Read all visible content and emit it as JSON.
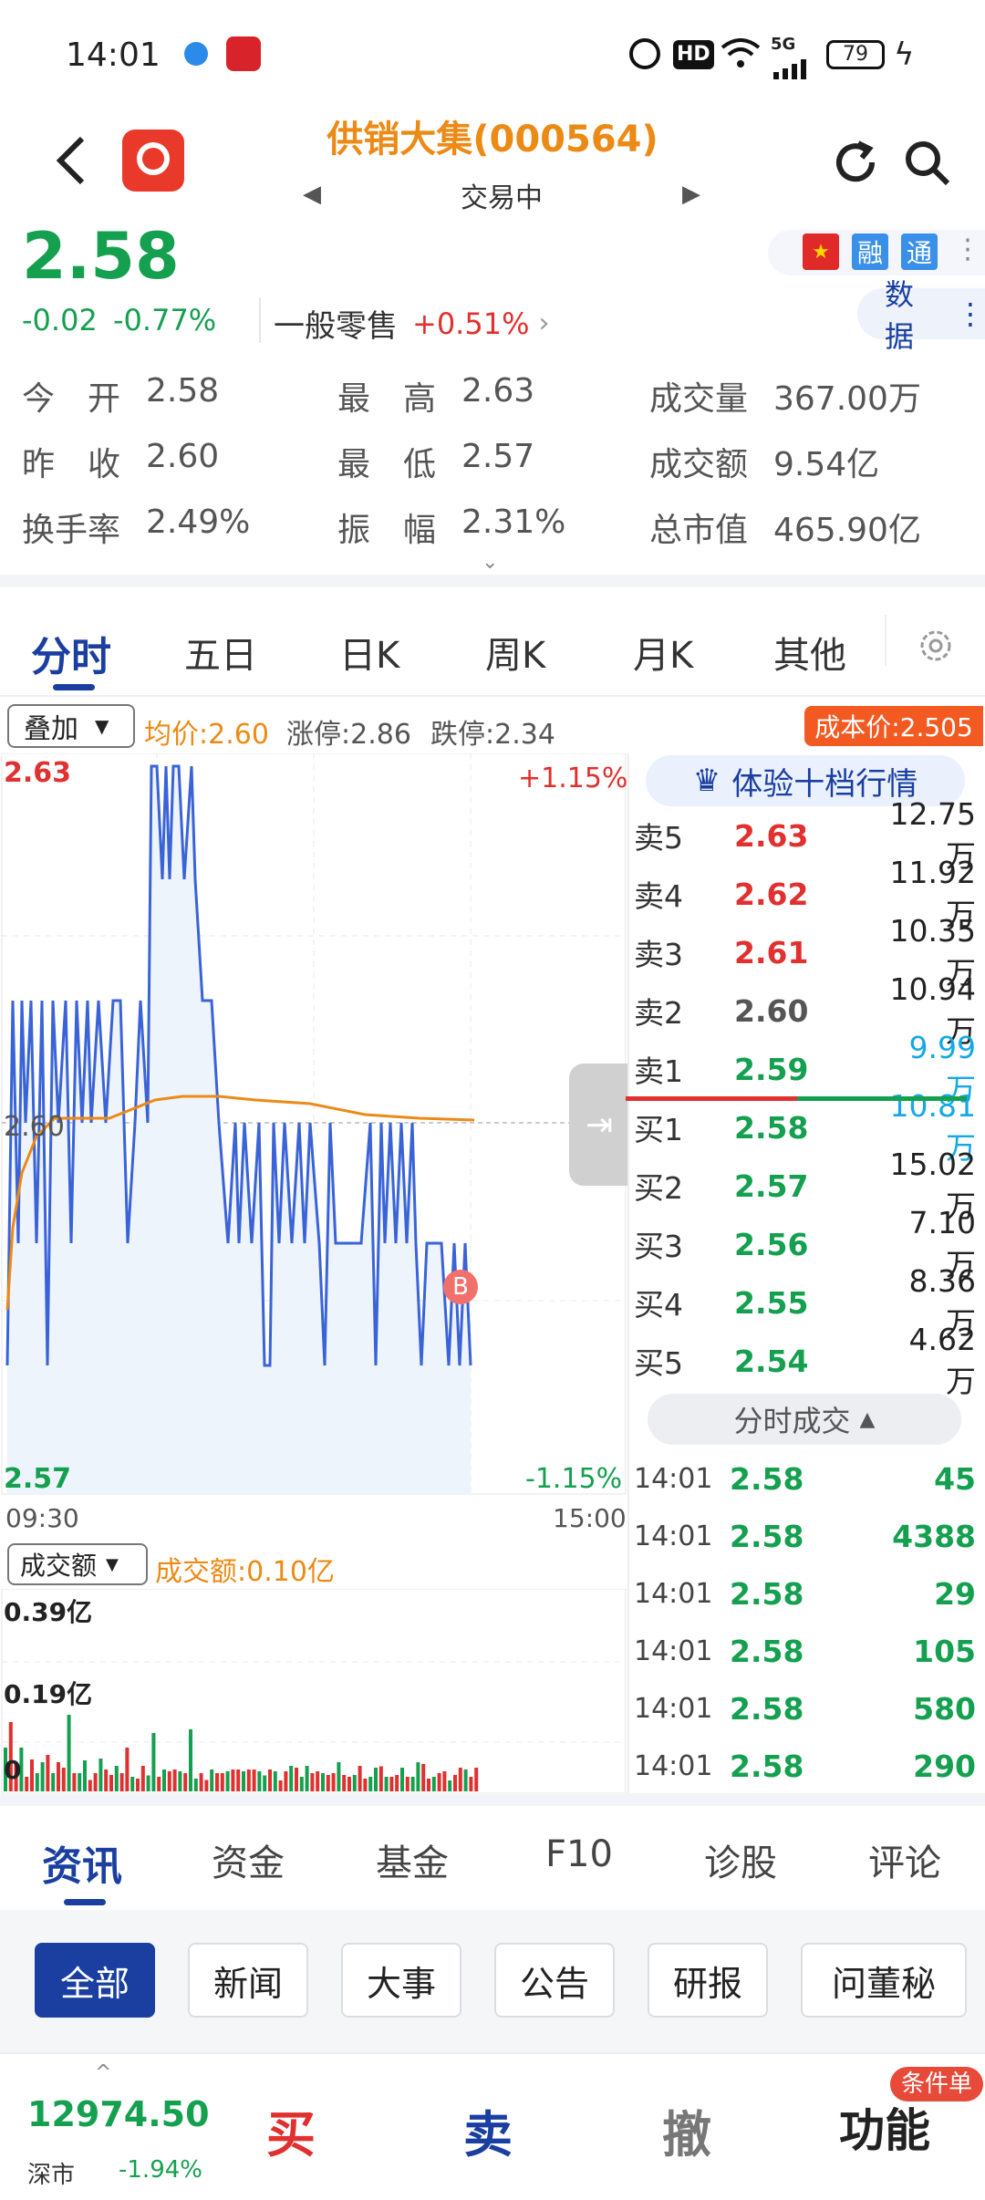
{
  "status_bar": {
    "time": "14:01",
    "hd": "HD",
    "signal": "5G",
    "battery": "79"
  },
  "header": {
    "title": "供销大集(000564)",
    "subtitle": "交易中"
  },
  "quote": {
    "price": "2.58",
    "change": "-0.02",
    "change_pct": "-0.77%",
    "sector": "一般零售",
    "sector_pct": "+0.51%",
    "tags": [
      "融",
      "通"
    ],
    "data_btn": "数据"
  },
  "stats": [
    [
      {
        "label": "今　开",
        "value": "2.58"
      },
      {
        "label": "最　高",
        "value": "2.63"
      },
      {
        "label": "成交量",
        "value": "367.00万"
      }
    ],
    [
      {
        "label": "昨　收",
        "value": "2.60"
      },
      {
        "label": "最　低",
        "value": "2.57"
      },
      {
        "label": "成交额",
        "value": "9.54亿"
      }
    ],
    [
      {
        "label": "换手率",
        "value": "2.49%"
      },
      {
        "label": "振　幅",
        "value": "2.31%"
      },
      {
        "label": "总市值",
        "value": "465.90亿"
      }
    ]
  ],
  "chart_tabs": [
    "分时",
    "五日",
    "日K",
    "周K",
    "月K",
    "其他"
  ],
  "overlay": {
    "select": "叠加",
    "avg_price": "均价:2.60",
    "limit_up": "涨停:2.86",
    "limit_down": "跌停:2.34",
    "cost_price": "成本价:2.505"
  },
  "intraday": {
    "y_max": "2.63",
    "y_mid": "2.60",
    "y_min": "2.57",
    "pct_max": "+1.15%",
    "pct_min": "-1.15%",
    "t_start": "09:30",
    "t_end": "15:00",
    "marker": "B"
  },
  "volume_panel": {
    "select": "成交额",
    "amount": "成交额:0.10亿",
    "y1": "0.39亿",
    "y2": "0.19亿",
    "y0": "0"
  },
  "orderbook": {
    "premium": "体验十档行情",
    "asks": [
      {
        "label": "卖5",
        "price": "2.63",
        "vol": "12.75万",
        "color": "red"
      },
      {
        "label": "卖4",
        "price": "2.62",
        "vol": "11.92万",
        "color": "red"
      },
      {
        "label": "卖3",
        "price": "2.61",
        "vol": "10.35万",
        "color": "red"
      },
      {
        "label": "卖2",
        "price": "2.60",
        "vol": "10.94万",
        "color": "gray"
      },
      {
        "label": "卖1",
        "price": "2.59",
        "vol": "9.99万",
        "color": "green"
      }
    ],
    "bids": [
      {
        "label": "买1",
        "price": "2.58",
        "vol": "10.81万",
        "color": "green"
      },
      {
        "label": "买2",
        "price": "2.57",
        "vol": "15.02万",
        "color": "green"
      },
      {
        "label": "买3",
        "price": "2.56",
        "vol": "7.10万",
        "color": "green"
      },
      {
        "label": "买4",
        "price": "2.55",
        "vol": "8.36万",
        "color": "green"
      },
      {
        "label": "买5",
        "price": "2.54",
        "vol": "4.62万",
        "color": "green"
      }
    ],
    "trades_title": "分时成交",
    "trades": [
      {
        "time": "14:01",
        "price": "2.58",
        "vol": "45"
      },
      {
        "time": "14:01",
        "price": "2.58",
        "vol": "4388"
      },
      {
        "time": "14:01",
        "price": "2.58",
        "vol": "29"
      },
      {
        "time": "14:01",
        "price": "2.58",
        "vol": "105"
      },
      {
        "time": "14:01",
        "price": "2.58",
        "vol": "580"
      },
      {
        "time": "14:01",
        "price": "2.58",
        "vol": "290"
      }
    ]
  },
  "news_tabs": [
    "资讯",
    "资金",
    "基金",
    "F10",
    "诊股",
    "评论"
  ],
  "chips": [
    "全部",
    "新闻",
    "大事",
    "公告",
    "研报",
    "问董秘"
  ],
  "bottom": {
    "index_value": "12974.50",
    "index_name": "深市",
    "index_pct": "-1.94%",
    "buy": "买",
    "sell": "卖",
    "cancel": "撤",
    "func": "功能",
    "cond_badge": "条件单"
  },
  "colors": {
    "up": "#e0302f",
    "down": "#15a050",
    "accent": "#1a3fa0",
    "orange": "#ec8a16",
    "line": "#3a63d8",
    "avg": "#ec8a16"
  }
}
